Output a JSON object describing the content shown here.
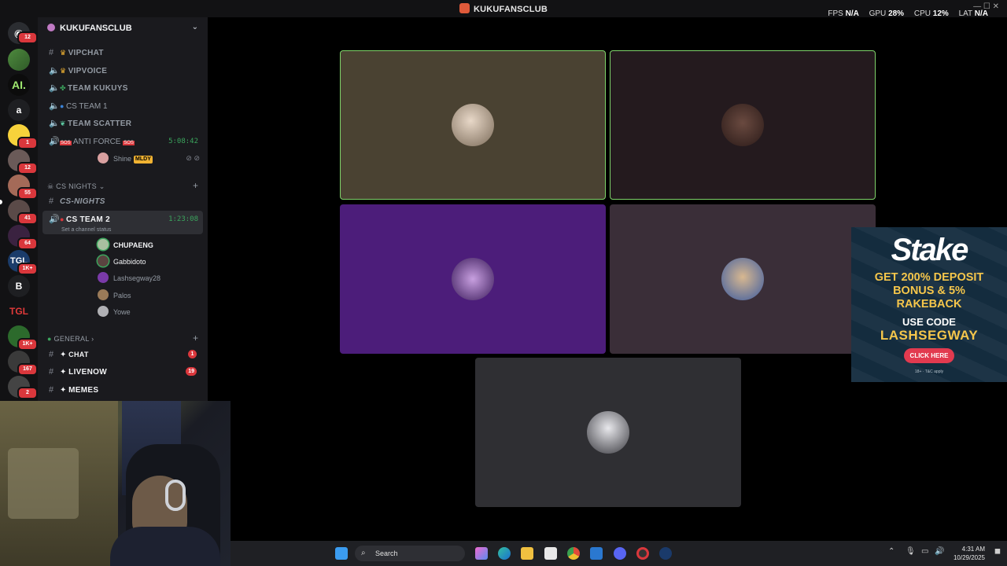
{
  "window": {
    "title": "KUKUFANSCLUB"
  },
  "perf": {
    "fps_label": "FPS",
    "fps": "N/A",
    "gpu_label": "GPU",
    "gpu": "28%",
    "cpu_label": "CPU",
    "cpu": "12%",
    "lat_label": "LAT",
    "lat": "N/A"
  },
  "rail": {
    "badges": [
      "12",
      "1",
      "12",
      "55",
      "41",
      "64",
      "1K+",
      "1K+",
      "167",
      "2"
    ],
    "letters": [
      "a",
      "B"
    ]
  },
  "sidebar": {
    "server_name": "KUKUFANSCLUB",
    "channels": [
      {
        "name": "VIPCHAT",
        "icon": "hash-icon"
      },
      {
        "name": "VIPVOICE",
        "icon": "speaker-icon"
      },
      {
        "name": "TEAM KUKUYS",
        "icon": "speaker-icon"
      },
      {
        "name": "CS TEAM 1",
        "icon": "speaker-icon"
      },
      {
        "name": "TEAM SCATTER",
        "icon": "speaker-icon"
      },
      {
        "name": "ANTI FORCE",
        "icon": "speaker-icon",
        "timer": "5:08:42"
      }
    ],
    "anti_force_user": {
      "name": "Shine",
      "tag": "MLDY"
    },
    "category_cs": "CS NIGHTS",
    "cs_nights_channel": "CS-NIGHTS",
    "cs_team2": {
      "name": "CS TEAM 2",
      "timer": "1:23:08",
      "status": "Set a channel status"
    },
    "cs_team2_users": [
      "CHUPAENG",
      "Gabbidoto",
      "Lashsegway28",
      "Palos",
      "Yowe"
    ],
    "category_general": "GENERAL",
    "general_channels": [
      {
        "name": "CHAT",
        "badge": "1"
      },
      {
        "name": "LIVENOW",
        "badge": "19"
      },
      {
        "name": "MEMES",
        "badge": ""
      }
    ]
  },
  "ad": {
    "brand": "Stake",
    "line1": "GET 200% DEPOSIT",
    "line2": "BONUS & 5%",
    "line3": "RAKEBACK",
    "line4": "USE CODE",
    "code": "LASHSEGWAY",
    "button": "CLICK HERE",
    "fine": "18+ · T&C apply"
  },
  "taskbar": {
    "search_placeholder": "Search",
    "time": "4:31 AM",
    "date": "10/29/2025"
  },
  "colors": {
    "speaking_border": "#7fd46a",
    "tile1": "#4a4232",
    "tile2": "#241a1e",
    "tile3": "#4c1d7a",
    "tile4": "#3a2e38",
    "tile5": "#2f2f33"
  }
}
